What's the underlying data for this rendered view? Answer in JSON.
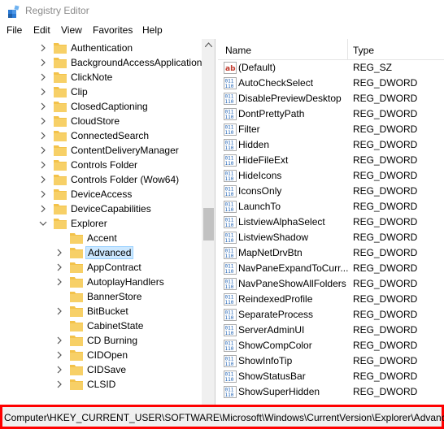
{
  "window": {
    "title": "Registry Editor"
  },
  "menu": [
    "File",
    "Edit",
    "View",
    "Favorites",
    "Help"
  ],
  "tree": [
    {
      "label": "Authentication",
      "level": 1,
      "expanded": false,
      "selected": false
    },
    {
      "label": "BackgroundAccessApplication",
      "level": 1,
      "expanded": false,
      "selected": false
    },
    {
      "label": "ClickNote",
      "level": 1,
      "expanded": false,
      "selected": false
    },
    {
      "label": "Clip",
      "level": 1,
      "expanded": false,
      "selected": false
    },
    {
      "label": "ClosedCaptioning",
      "level": 1,
      "expanded": false,
      "selected": false
    },
    {
      "label": "CloudStore",
      "level": 1,
      "expanded": false,
      "selected": false
    },
    {
      "label": "ConnectedSearch",
      "level": 1,
      "expanded": false,
      "selected": false
    },
    {
      "label": "ContentDeliveryManager",
      "level": 1,
      "expanded": false,
      "selected": false
    },
    {
      "label": "Controls Folder",
      "level": 1,
      "expanded": false,
      "selected": false
    },
    {
      "label": "Controls Folder (Wow64)",
      "level": 1,
      "expanded": false,
      "selected": false
    },
    {
      "label": "DeviceAccess",
      "level": 1,
      "expanded": false,
      "selected": false
    },
    {
      "label": "DeviceCapabilities",
      "level": 1,
      "expanded": false,
      "selected": false
    },
    {
      "label": "Explorer",
      "level": 1,
      "expanded": true,
      "selected": false
    },
    {
      "label": "Accent",
      "level": 2,
      "expanded": false,
      "selected": false,
      "nochev": true
    },
    {
      "label": "Advanced",
      "level": 2,
      "expanded": false,
      "selected": true
    },
    {
      "label": "AppContract",
      "level": 2,
      "expanded": false,
      "selected": false
    },
    {
      "label": "AutoplayHandlers",
      "level": 2,
      "expanded": false,
      "selected": false
    },
    {
      "label": "BannerStore",
      "level": 2,
      "expanded": false,
      "selected": false,
      "nochev": true
    },
    {
      "label": "BitBucket",
      "level": 2,
      "expanded": false,
      "selected": false
    },
    {
      "label": "CabinetState",
      "level": 2,
      "expanded": false,
      "selected": false,
      "nochev": true
    },
    {
      "label": "CD Burning",
      "level": 2,
      "expanded": false,
      "selected": false
    },
    {
      "label": "CIDOpen",
      "level": 2,
      "expanded": false,
      "selected": false
    },
    {
      "label": "CIDSave",
      "level": 2,
      "expanded": false,
      "selected": false
    },
    {
      "label": "CLSID",
      "level": 2,
      "expanded": false,
      "selected": false
    }
  ],
  "list": {
    "headers": {
      "name": "Name",
      "type": "Type"
    },
    "rows": [
      {
        "name": "(Default)",
        "type": "REG_SZ",
        "icon": "string-value-icon"
      },
      {
        "name": "AutoCheckSelect",
        "type": "REG_DWORD",
        "icon": "binary-value-icon"
      },
      {
        "name": "DisablePreviewDesktop",
        "type": "REG_DWORD",
        "icon": "binary-value-icon"
      },
      {
        "name": "DontPrettyPath",
        "type": "REG_DWORD",
        "icon": "binary-value-icon"
      },
      {
        "name": "Filter",
        "type": "REG_DWORD",
        "icon": "binary-value-icon"
      },
      {
        "name": "Hidden",
        "type": "REG_DWORD",
        "icon": "binary-value-icon"
      },
      {
        "name": "HideFileExt",
        "type": "REG_DWORD",
        "icon": "binary-value-icon"
      },
      {
        "name": "HideIcons",
        "type": "REG_DWORD",
        "icon": "binary-value-icon"
      },
      {
        "name": "IconsOnly",
        "type": "REG_DWORD",
        "icon": "binary-value-icon"
      },
      {
        "name": "LaunchTo",
        "type": "REG_DWORD",
        "icon": "binary-value-icon"
      },
      {
        "name": "ListviewAlphaSelect",
        "type": "REG_DWORD",
        "icon": "binary-value-icon"
      },
      {
        "name": "ListviewShadow",
        "type": "REG_DWORD",
        "icon": "binary-value-icon"
      },
      {
        "name": "MapNetDrvBtn",
        "type": "REG_DWORD",
        "icon": "binary-value-icon"
      },
      {
        "name": "NavPaneExpandToCurr...",
        "type": "REG_DWORD",
        "icon": "binary-value-icon"
      },
      {
        "name": "NavPaneShowAllFolders",
        "type": "REG_DWORD",
        "icon": "binary-value-icon"
      },
      {
        "name": "ReindexedProfile",
        "type": "REG_DWORD",
        "icon": "binary-value-icon"
      },
      {
        "name": "SeparateProcess",
        "type": "REG_DWORD",
        "icon": "binary-value-icon"
      },
      {
        "name": "ServerAdminUI",
        "type": "REG_DWORD",
        "icon": "binary-value-icon"
      },
      {
        "name": "ShowCompColor",
        "type": "REG_DWORD",
        "icon": "binary-value-icon"
      },
      {
        "name": "ShowInfoTip",
        "type": "REG_DWORD",
        "icon": "binary-value-icon"
      },
      {
        "name": "ShowStatusBar",
        "type": "REG_DWORD",
        "icon": "binary-value-icon"
      },
      {
        "name": "ShowSuperHidden",
        "type": "REG_DWORD",
        "icon": "binary-value-icon"
      }
    ]
  },
  "status": {
    "path": "Computer\\HKEY_CURRENT_USER\\SOFTWARE\\Microsoft\\Windows\\CurrentVersion\\Explorer\\Advanced"
  },
  "colors": {
    "folder": "#f3c24a",
    "selection": "#cce8ff",
    "highlight_border": "#ff0000",
    "binary_icon": "#1a5fb4"
  }
}
